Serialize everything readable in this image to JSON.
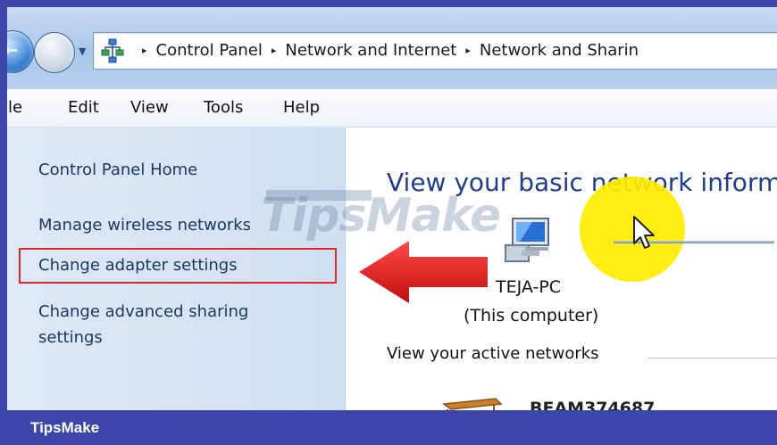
{
  "address_bar": {
    "breadcrumbs": [
      "Control Panel",
      "Network and Internet",
      "Network and Sharin"
    ],
    "separator": "▸"
  },
  "menu": {
    "items": [
      "ile",
      "Edit",
      "View",
      "Tools",
      "Help"
    ]
  },
  "left_pane": {
    "home_link": "Control Panel Home",
    "wireless_link": "Manage wireless networks",
    "adapter_link": "Change adapter settings",
    "sharing_link_line1": "Change advanced sharing",
    "sharing_link_line2": "settings"
  },
  "main": {
    "title": "View your basic network inform",
    "computer_name": "TEJA-PC",
    "computer_sub": "(This computer)",
    "active_networks_label": "View your active networks",
    "network_partial": "BEAM374687"
  },
  "watermark": {
    "text": "TipsMake"
  },
  "brand_bar": {
    "label": "TipsMake"
  },
  "colors": {
    "brand_blue": "#3b46a8",
    "highlight_red": "#e02a2a",
    "title_blue": "#1e3d8a",
    "cursor_halo": "#ffec00"
  },
  "icons": {
    "back": "back-arrow-icon",
    "forward": "forward-arrow-icon",
    "network": "network-icon",
    "computer": "computer-icon",
    "cursor": "mouse-cursor-icon",
    "annotation": "red-arrow-icon"
  }
}
